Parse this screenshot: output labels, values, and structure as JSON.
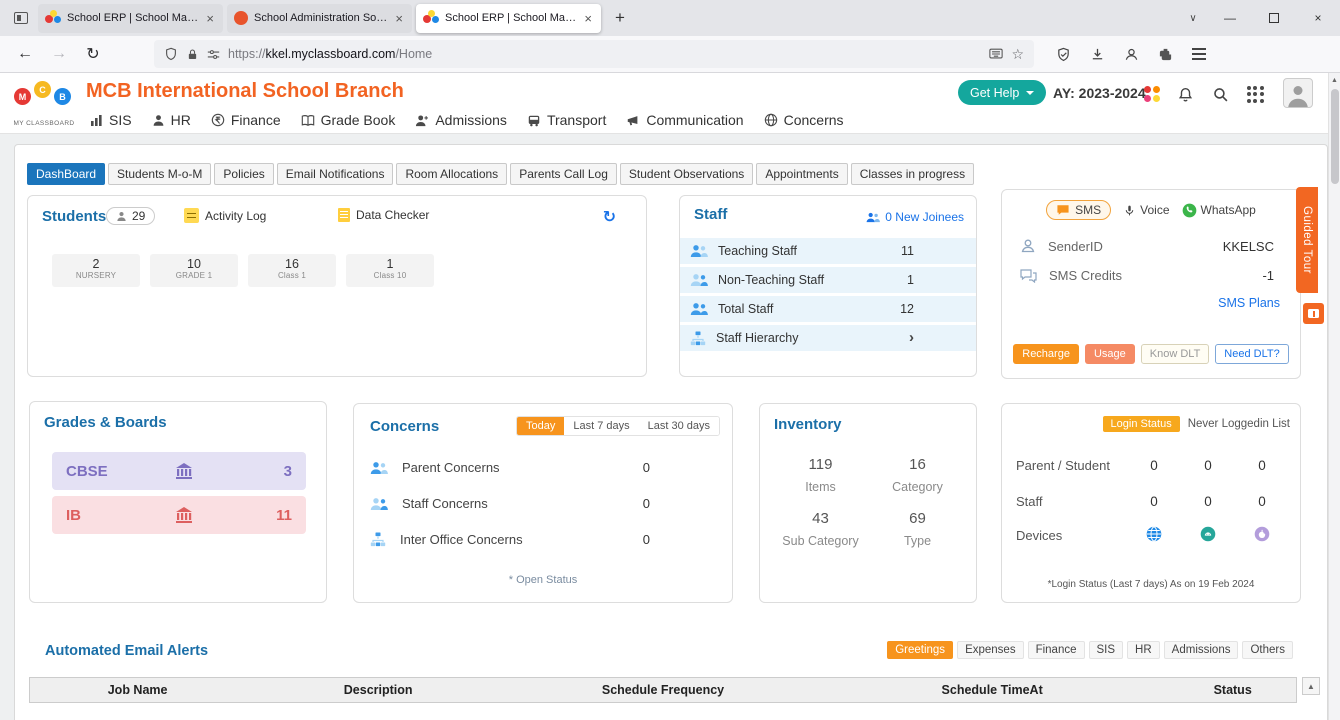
{
  "colors": {
    "brand_orange": "#f26322",
    "accent_orange": "#f7941d",
    "teal_button": "#14a79d",
    "active_tab_blue": "#1b75bc",
    "card_title_blue": "#1b6fa8",
    "link_blue": "#1a73e8",
    "cbse_purple": "#7d6fc0",
    "ib_red": "#dd5f5f",
    "whatsapp_green": "#3bb54a",
    "guided_tour_orange": "#f26722",
    "staff_row_blue": "#e9f4fb"
  },
  "glyphs": {
    "back": "←",
    "forward": "→",
    "refresh": "↻",
    "star": "☆",
    "close": "×",
    "plus": "+",
    "chevron_down": "∨",
    "minimize": "—",
    "up_arrow": "▲"
  },
  "browser": {
    "tabs": [
      {
        "title": "School ERP | School Manageme"
      },
      {
        "title": "School Administration Software"
      },
      {
        "title": "School ERP | School Manageme"
      }
    ],
    "url_scheme": "https://",
    "url_host": "kkel.myclassboard.com",
    "url_path": "/Home"
  },
  "header": {
    "school_name": "MCB International School Branch",
    "logo_letters": [
      "M",
      "C",
      "B"
    ],
    "logo_caption": "MY CLASSBOARD",
    "get_help_label": "Get Help",
    "academic_year": "AY: 2023-2024"
  },
  "nav": {
    "items": [
      "SIS",
      "HR",
      "Finance",
      "Grade Book",
      "Admissions",
      "Transport",
      "Communication",
      "Concerns"
    ]
  },
  "page_tabs": [
    "DashBoard",
    "Students M-o-M",
    "Policies",
    "Email Notifications",
    "Room Allocations",
    "Parents Call Log",
    "Student Observations",
    "Appointments",
    "Classes in progress"
  ],
  "students": {
    "title": "Students",
    "count": "29",
    "activity_log_label": "Activity Log",
    "data_checker_label": "Data Checker",
    "stats": [
      {
        "value": "2",
        "label": "NURSERY"
      },
      {
        "value": "10",
        "label": "GRADE 1"
      },
      {
        "value": "16",
        "label": "Class 1"
      },
      {
        "value": "1",
        "label": "Class 10"
      }
    ]
  },
  "staff": {
    "title": "Staff",
    "new_joinees_label": "0 New Joinees",
    "rows": [
      {
        "label": "Teaching Staff",
        "value": "11"
      },
      {
        "label": "Non-Teaching Staff",
        "value": "1"
      },
      {
        "label": "Total Staff",
        "value": "12"
      },
      {
        "label": "Staff Hierarchy",
        "value": "›"
      }
    ]
  },
  "sms": {
    "tab_sms": "SMS",
    "tab_voice": "Voice",
    "tab_whatsapp": "WhatsApp",
    "sender_id_label": "SenderID",
    "sender_id_value": "KKELSC",
    "credits_label": "SMS Credits",
    "credits_value": "-1",
    "plans_link": "SMS Plans",
    "buttons": [
      "Recharge",
      "Usage",
      "Know DLT",
      "Need DLT?"
    ]
  },
  "guided_tour_label": "Guided Tour",
  "grades": {
    "title": "Grades & Boards",
    "rows": [
      {
        "label": "CBSE",
        "value": "3"
      },
      {
        "label": "IB",
        "value": "11"
      }
    ]
  },
  "concerns": {
    "title": "Concerns",
    "filters": [
      "Today",
      "Last 7 days",
      "Last 30 days"
    ],
    "rows": [
      {
        "label": "Parent Concerns",
        "value": "0"
      },
      {
        "label": "Staff Concerns",
        "value": "0"
      },
      {
        "label": "Inter Office Concerns",
        "value": "0"
      }
    ],
    "footnote": "* Open Status"
  },
  "inventory": {
    "title": "Inventory",
    "stats": [
      {
        "value": "119",
        "label": "Items"
      },
      {
        "value": "16",
        "label": "Category"
      },
      {
        "value": "43",
        "label": "Sub Category"
      },
      {
        "value": "69",
        "label": "Type"
      }
    ]
  },
  "login_status": {
    "tab_active": "Login Status",
    "tab_inactive": "Never Loggedin List",
    "rows": [
      {
        "label": "Parent / Student",
        "values": [
          "0",
          "0",
          "0"
        ]
      },
      {
        "label": "Staff",
        "values": [
          "0",
          "0",
          "0"
        ]
      }
    ],
    "devices_label": "Devices",
    "footnote": "*Login Status (Last 7 days) As on 19 Feb 2024"
  },
  "email_alerts": {
    "title": "Automated Email Alerts",
    "filters": [
      "Greetings",
      "Expenses",
      "Finance",
      "SIS",
      "HR",
      "Admissions",
      "Others"
    ],
    "columns": [
      "Job Name",
      "Description",
      "Schedule Frequency",
      "Schedule TimeAt",
      "Status"
    ]
  }
}
